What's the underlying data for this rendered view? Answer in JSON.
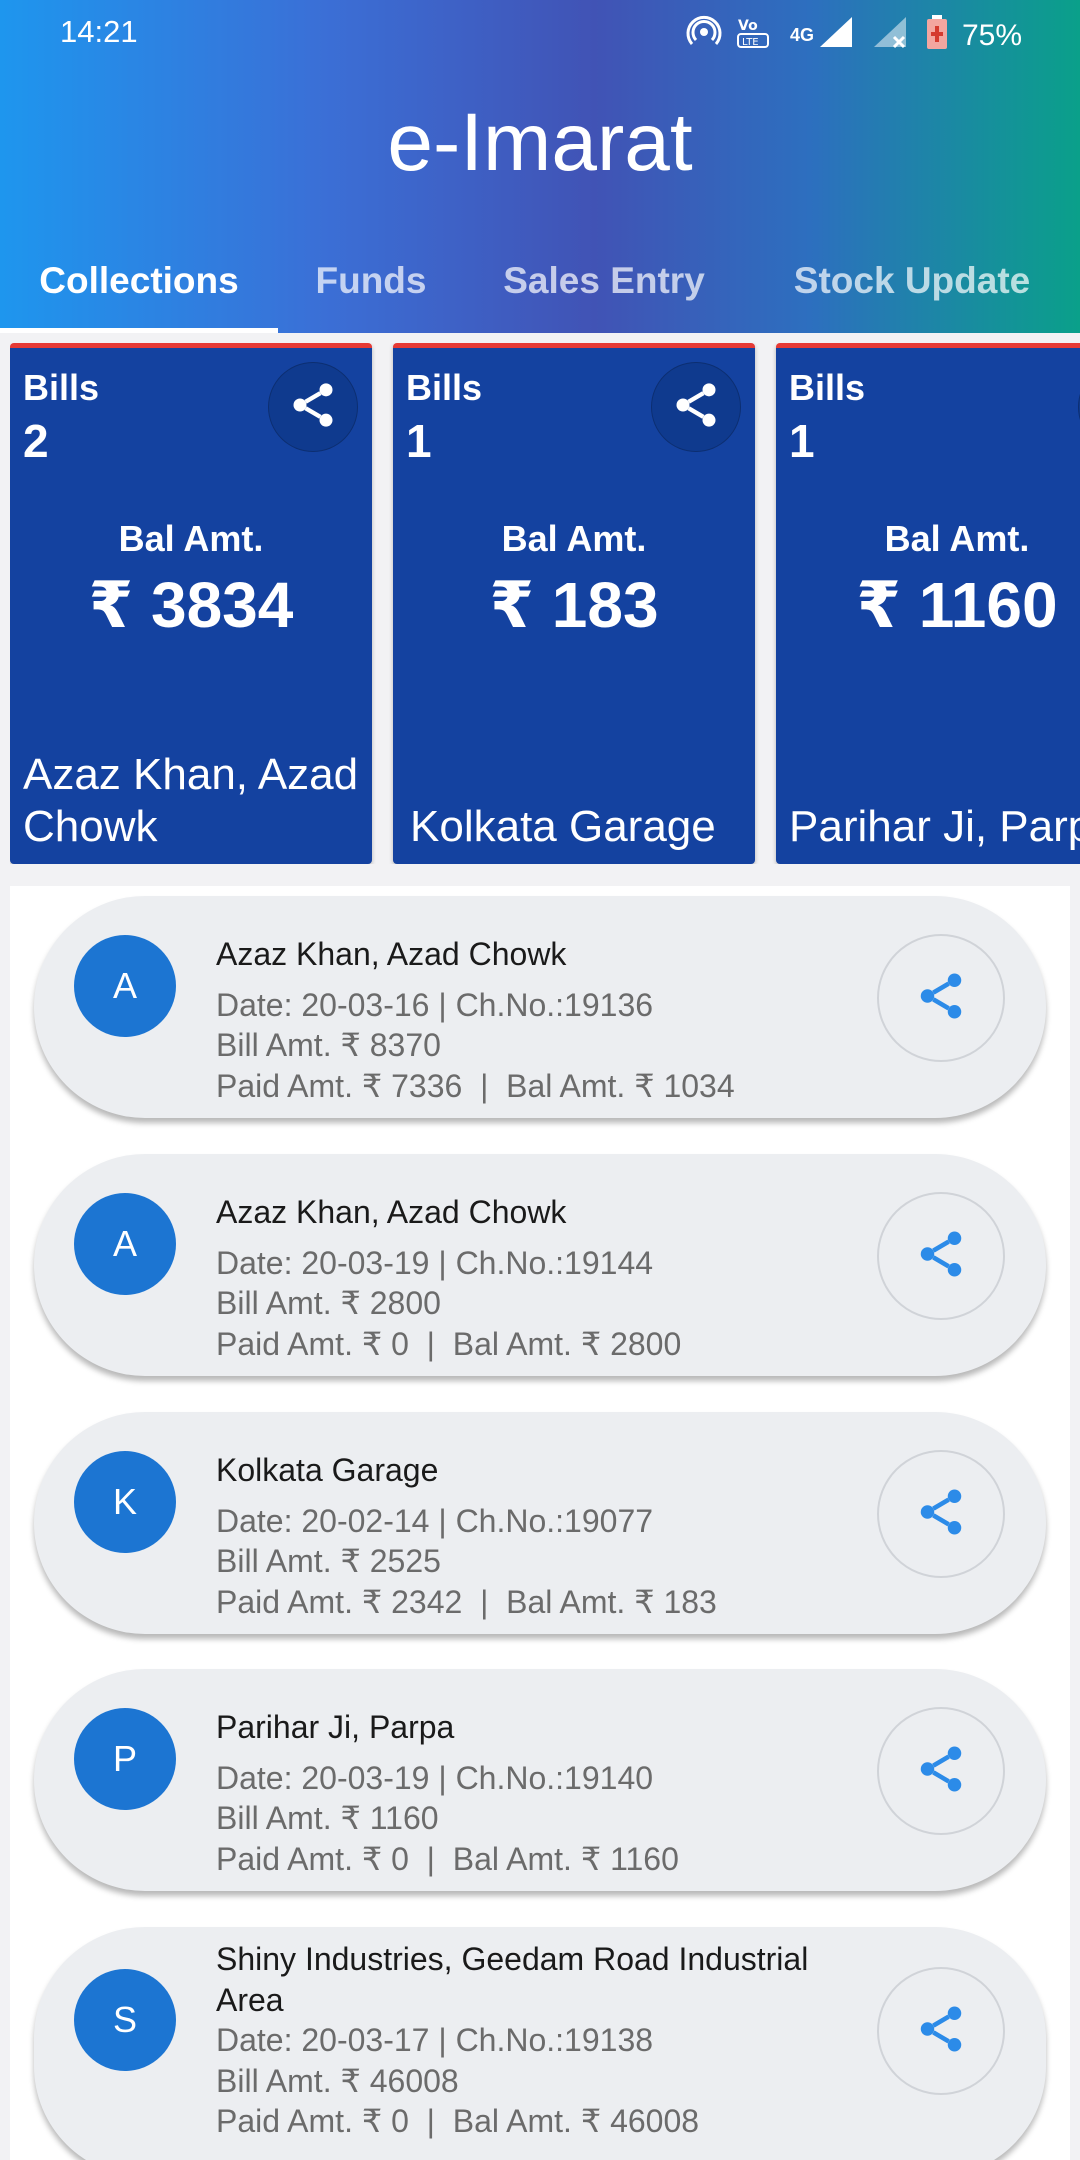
{
  "status_bar": {
    "time": "14:21",
    "network": "4G",
    "battery": "75%"
  },
  "app": {
    "title": "e-Imarat"
  },
  "tabs": [
    {
      "label": "Collections",
      "active": true
    },
    {
      "label": "Funds",
      "active": false
    },
    {
      "label": "Sales Entry",
      "active": false
    },
    {
      "label": "Stock Update",
      "active": false
    }
  ],
  "summary_cards": [
    {
      "bills_label": "Bills",
      "bills_count": "2",
      "bal_label": "Bal Amt.",
      "bal_amount": "₹ 3834",
      "customer": "Azaz Khan, Azad Chowk"
    },
    {
      "bills_label": "Bills",
      "bills_count": "1",
      "bal_label": "Bal Amt.",
      "bal_amount": "₹ 183",
      "customer": "Kolkata Garage"
    },
    {
      "bills_label": "Bills",
      "bills_count": "1",
      "bal_label": "Bal Amt.",
      "bal_amount": "₹ 1160",
      "customer": "Parihar Ji, Parpa"
    }
  ],
  "bills": [
    {
      "initial": "A",
      "name": "Azaz Khan, Azad Chowk",
      "date_line": "Date: 20-03-16 | Ch.No.:19136",
      "bill_line": "Bill Amt. ₹ 8370",
      "paid_line": "Paid Amt. ₹ 7336  |  Bal Amt. ₹ 1034"
    },
    {
      "initial": "A",
      "name": "Azaz Khan, Azad Chowk",
      "date_line": "Date: 20-03-19 | Ch.No.:19144",
      "bill_line": "Bill Amt. ₹ 2800",
      "paid_line": "Paid Amt. ₹ 0  |  Bal Amt. ₹ 2800"
    },
    {
      "initial": "K",
      "name": "Kolkata Garage",
      "date_line": "Date: 20-02-14 | Ch.No.:19077",
      "bill_line": "Bill Amt. ₹ 2525",
      "paid_line": "Paid Amt. ₹ 2342  |  Bal Amt. ₹ 183"
    },
    {
      "initial": "P",
      "name": "Parihar Ji, Parpa",
      "date_line": "Date: 20-03-19 | Ch.No.:19140",
      "bill_line": "Bill Amt. ₹ 1160",
      "paid_line": "Paid Amt. ₹ 0  |  Bal Amt. ₹ 1160"
    },
    {
      "initial": "S",
      "name": "Shiny Industries, Geedam Road Industrial Area",
      "date_line": "Date: 20-03-17 | Ch.No.:19138",
      "bill_line": "Bill Amt. ₹ 46008",
      "paid_line": "Paid Amt. ₹ 0  |  Bal Amt. ₹ 46008"
    }
  ],
  "icons": {
    "share": "share-icon",
    "hotspot": "hotspot-icon",
    "volte": "volte-icon",
    "signal": "signal-icon",
    "battery": "battery-icon"
  },
  "colors": {
    "card_blue": "#1442a0",
    "card_accent": "#e63a35",
    "avatar_blue": "#1c75d2",
    "share_blue": "#2c8be8"
  }
}
